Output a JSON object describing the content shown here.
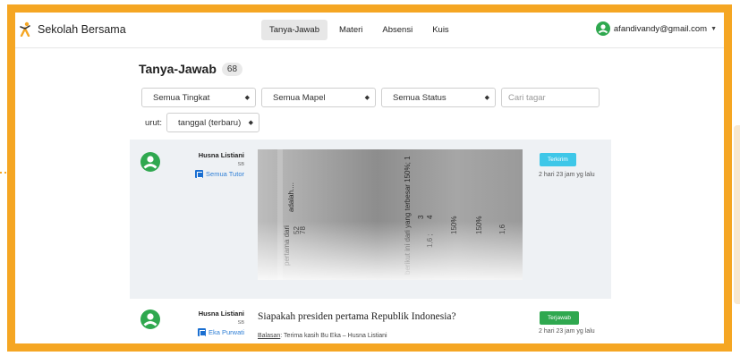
{
  "app": {
    "name": "Sekolah Bersama"
  },
  "nav": {
    "tabs": [
      {
        "label": "Tanya-Jawab",
        "active": true
      },
      {
        "label": "Materi",
        "active": false
      },
      {
        "label": "Absensi",
        "active": false
      },
      {
        "label": "Kuis",
        "active": false
      }
    ]
  },
  "user": {
    "email": "afandivandy@gmail.com"
  },
  "page": {
    "title": "Tanya-Jawab",
    "count": "68"
  },
  "filters": {
    "tingkat": "Semua Tingkat",
    "mapel": "Semua Mapel",
    "status": "Semua Status",
    "search_placeholder": "Cari tagar"
  },
  "sort": {
    "label": "urut:",
    "value": "tanggal (terbaru)"
  },
  "questions": [
    {
      "author": "Husna Listiani",
      "level": "SB",
      "tutor": "Semua Tutor",
      "status": "Terkirim",
      "time": "2 hari 23 jam yg lalu"
    },
    {
      "author": "Husna Listiani",
      "level": "SB",
      "tutor": "Eka Purwati",
      "text": "Siapakah presiden pertama Republik Indonesia?",
      "reply_label": "Balasan",
      "reply_text": ": Terima kasih Bu Eka – Husna Listiani",
      "status": "Terjawab",
      "time": "2 hari 23 jam yg lalu"
    }
  ],
  "colors": {
    "frame": "#f5a623",
    "waiting": "#3ec7e8",
    "answered": "#2fa84f",
    "avatar": "#2fa84f",
    "tutor": "#2f7fd6"
  }
}
